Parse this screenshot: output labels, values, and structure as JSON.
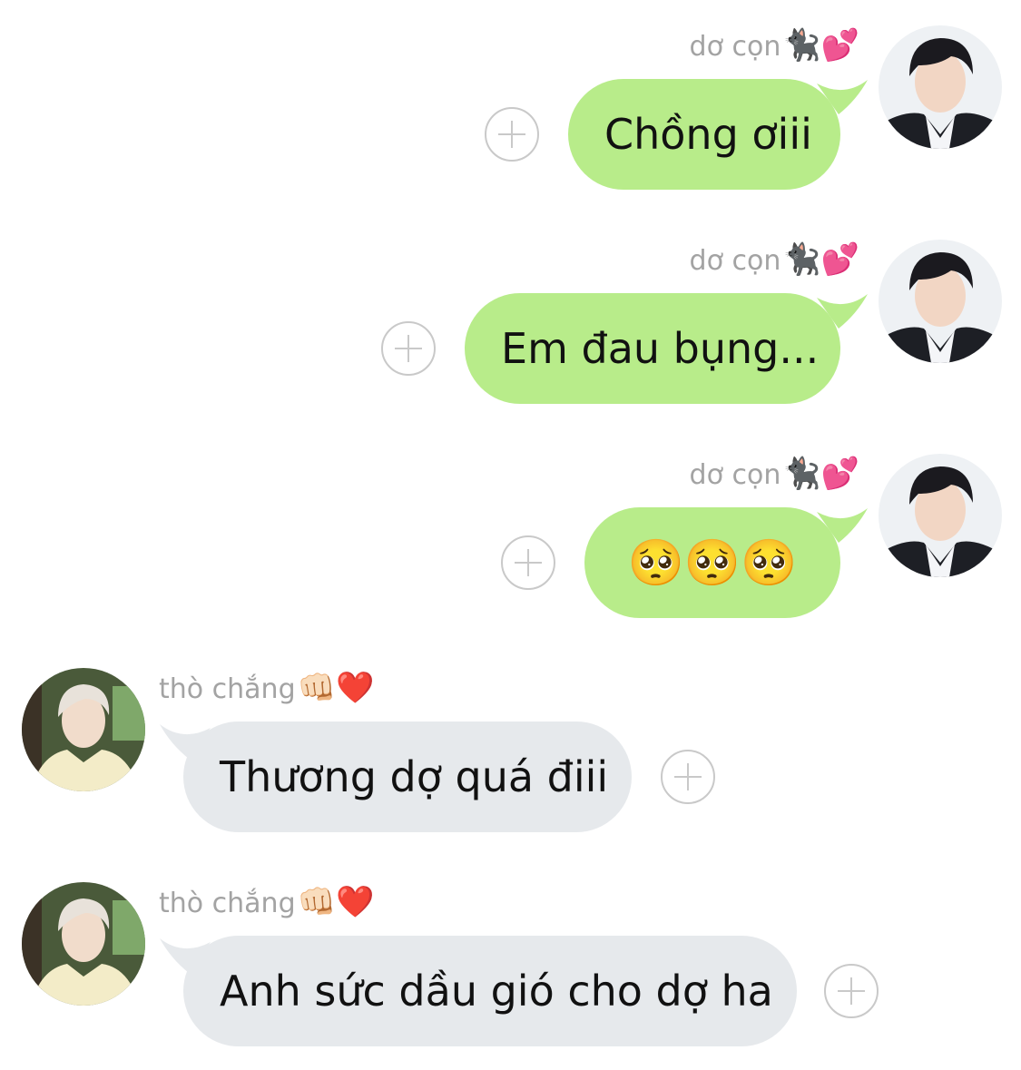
{
  "messages": [
    {
      "direction": "out",
      "sender": "dơ cọn",
      "sender_emoji": "🐈‍⬛💕",
      "text": "Chồng ơiii"
    },
    {
      "direction": "out",
      "sender": "dơ cọn",
      "sender_emoji": "🐈‍⬛💕",
      "text": "Em đau bụng..."
    },
    {
      "direction": "out",
      "sender": "dơ cọn",
      "sender_emoji": "🐈‍⬛💕",
      "text": "🥺🥺🥺"
    },
    {
      "direction": "in",
      "sender": "thò chắng",
      "sender_emoji": "👊🏻❤️",
      "text": "Thương dợ quá điii"
    },
    {
      "direction": "in",
      "sender": "thò chắng",
      "sender_emoji": "👊🏻❤️",
      "text": "Anh sức dầu gió cho dợ ha"
    }
  ],
  "colors": {
    "outgoing_bubble": "#b8ec8a",
    "incoming_bubble": "#e6e9ec",
    "sender_name": "#a3a3a3",
    "add_reaction_icon": "#c9c9c9"
  },
  "icons": {
    "add_reaction": "plus-circle-icon"
  }
}
